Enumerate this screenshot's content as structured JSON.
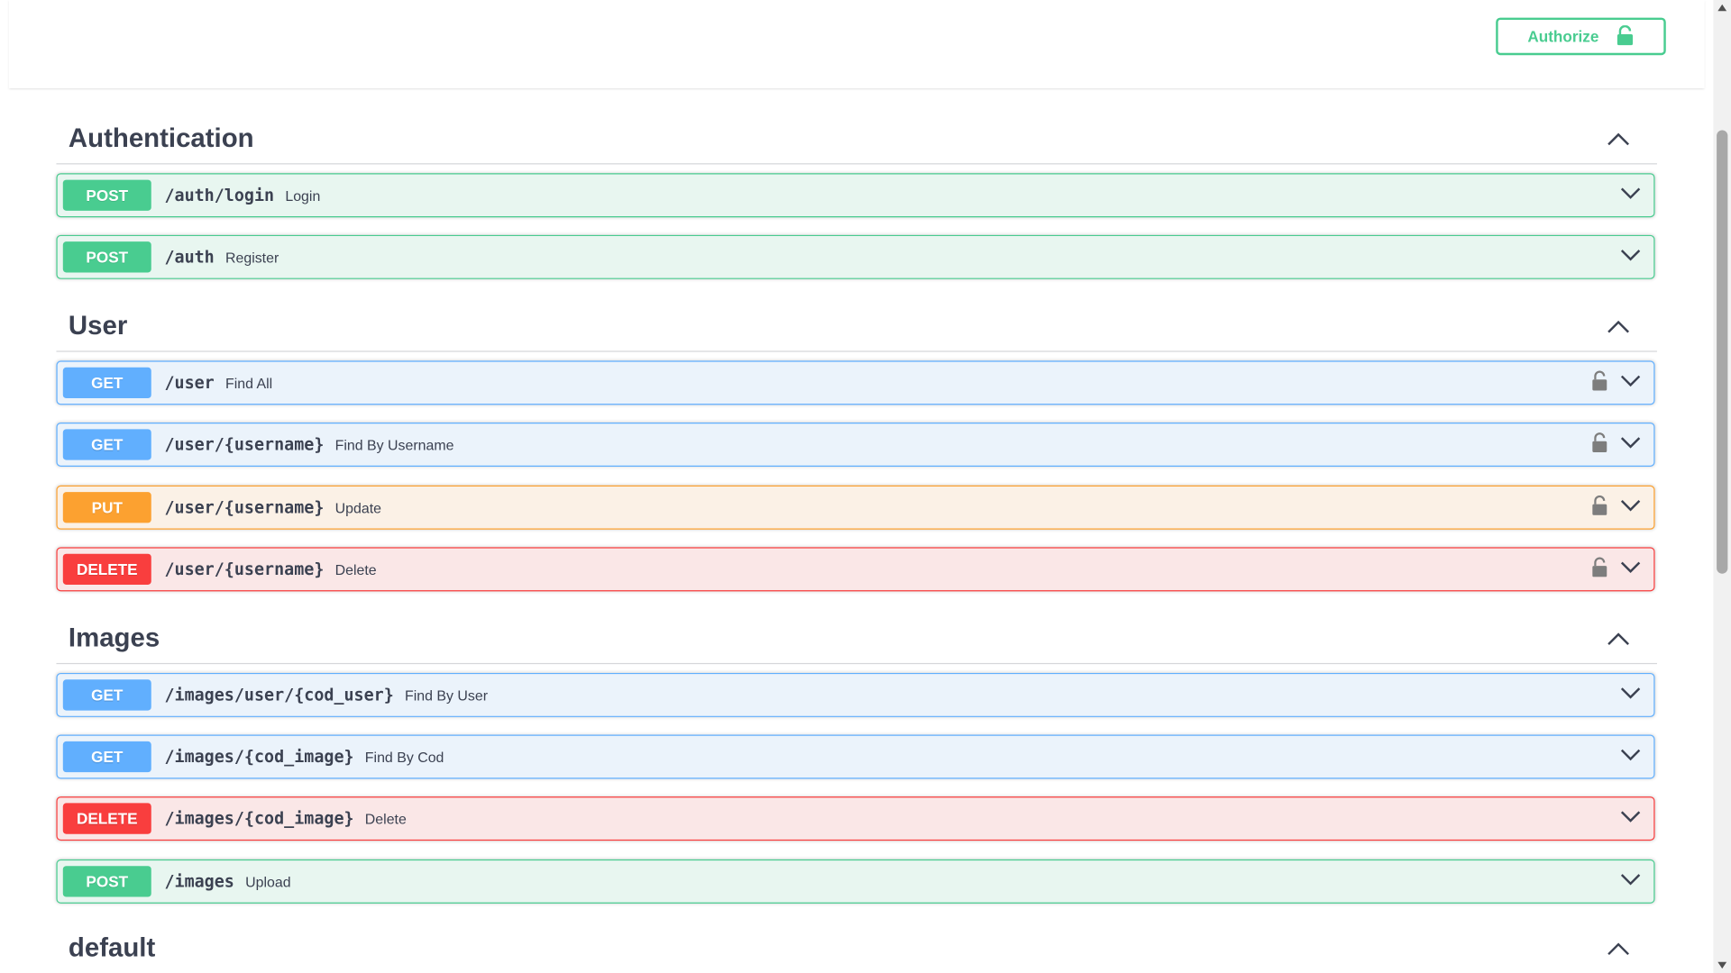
{
  "topbar": {
    "authorize_label": "Authorize"
  },
  "sections": [
    {
      "title": "Authentication"
    },
    {
      "title": "User"
    },
    {
      "title": "Images"
    },
    {
      "title": "default"
    }
  ],
  "operations": [
    {
      "method": "POST",
      "path": "/auth/login",
      "summary": "Login"
    },
    {
      "method": "POST",
      "path": "/auth",
      "summary": "Register"
    },
    {
      "method": "GET",
      "path": "/user",
      "summary": "Find All"
    },
    {
      "method": "GET",
      "path": "/user/{username}",
      "summary": "Find By Username"
    },
    {
      "method": "PUT",
      "path": "/user/{username}",
      "summary": "Update"
    },
    {
      "method": "DELETE",
      "path": "/user/{username}",
      "summary": "Delete"
    },
    {
      "method": "GET",
      "path": "/images/user/{cod_user}",
      "summary": "Find By User"
    },
    {
      "method": "GET",
      "path": "/images/{cod_image}",
      "summary": "Find By Cod"
    },
    {
      "method": "DELETE",
      "path": "/images/{cod_image}",
      "summary": "Delete"
    },
    {
      "method": "POST",
      "path": "/images",
      "summary": "Upload"
    }
  ],
  "colors": {
    "post": "#49cc90",
    "get": "#61affe",
    "put": "#fca130",
    "delete": "#f93e3e"
  },
  "icons": {
    "lock": "lock-icon",
    "expand": "chevron-down-icon",
    "collapse": "chevron-up-icon"
  }
}
